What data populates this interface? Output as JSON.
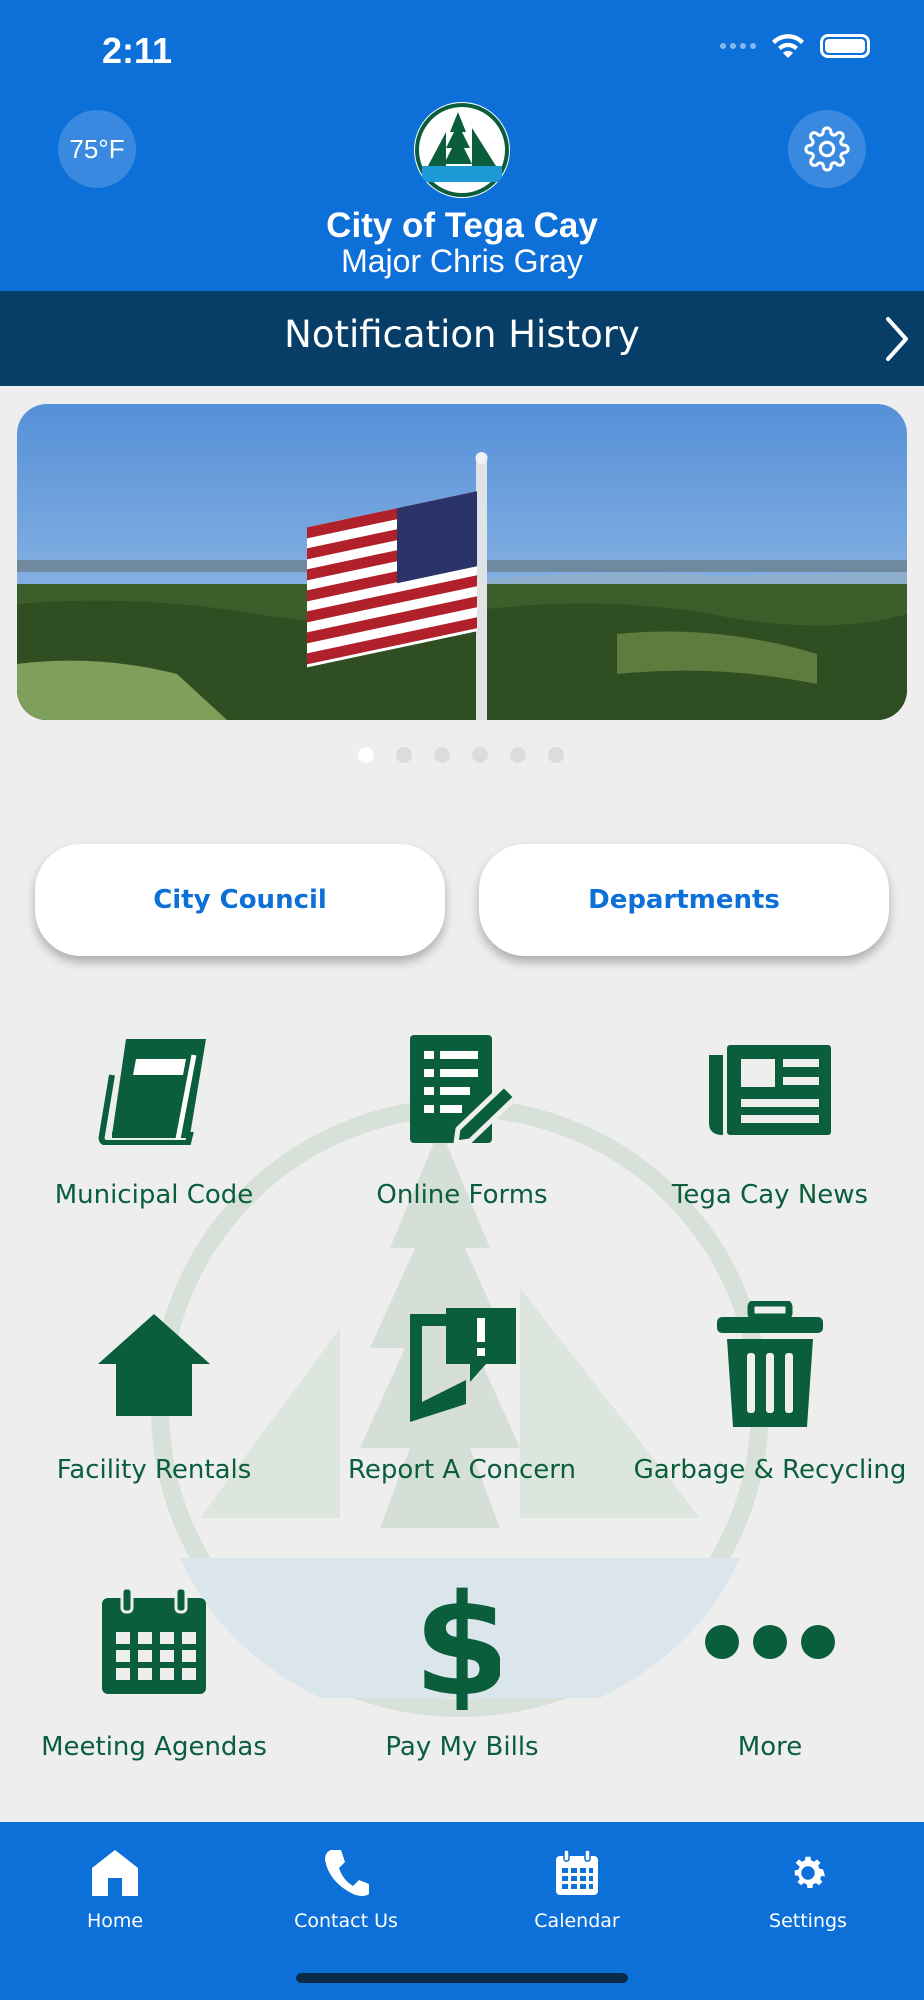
{
  "status_bar": {
    "time": "2:11"
  },
  "header": {
    "weather": "75°F",
    "city_name": "City of Tega Cay",
    "mayor": "Major Chris Gray"
  },
  "notification_bar": {
    "title": "Notification History"
  },
  "carousel": {
    "pages": 6,
    "active_index": 0
  },
  "pills": {
    "left": "City Council",
    "right": "Departments"
  },
  "grid": [
    {
      "label": "Municipal Code",
      "icon": "book-icon"
    },
    {
      "label": "Online Forms",
      "icon": "form-icon"
    },
    {
      "label": "Tega Cay News",
      "icon": "newspaper-icon"
    },
    {
      "label": "Facility Rentals",
      "icon": "home-icon"
    },
    {
      "label": "Report A Concern",
      "icon": "report-concern-icon"
    },
    {
      "label": "Garbage & Recycling",
      "icon": "trash-icon"
    },
    {
      "label": "Meeting Agendas",
      "icon": "calendar-icon"
    },
    {
      "label": "Pay My Bills",
      "icon": "dollar-icon"
    },
    {
      "label": "More",
      "icon": "more-icon"
    }
  ],
  "tabbar": [
    {
      "label": "Home",
      "icon": "home-icon"
    },
    {
      "label": "Contact Us",
      "icon": "phone-icon"
    },
    {
      "label": "Calendar",
      "icon": "calendar-icon"
    },
    {
      "label": "Settings",
      "icon": "gear-icon"
    }
  ],
  "colors": {
    "primary": "#0d6fd8",
    "dark_navy": "#073e68",
    "icon_green": "#0a5e3c",
    "background": "#eeeeee"
  }
}
